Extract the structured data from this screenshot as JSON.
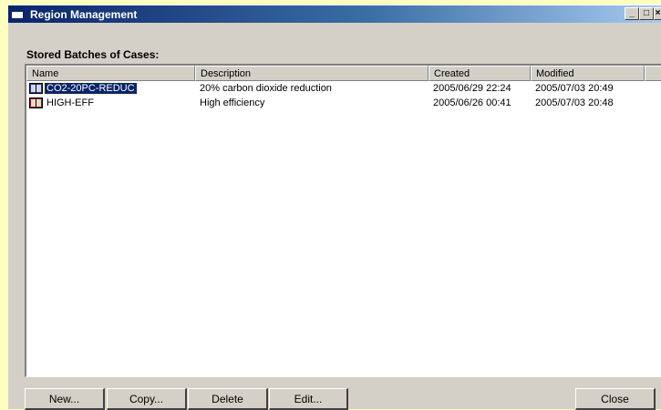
{
  "window": {
    "title": "Region Management",
    "min_glyph": "_",
    "max_glyph": "□",
    "close_glyph": "×"
  },
  "section_label": "Stored Batches of Cases:",
  "list": {
    "columns": [
      "Name",
      "Description",
      "Created",
      "Modified"
    ],
    "rows": [
      {
        "name": "CO2-20PC-REDUC",
        "description": "20% carbon dioxide reduction",
        "created": "2005/06/29 22:24",
        "modified": "2005/07/03 20:49",
        "selected": true
      },
      {
        "name": "HIGH-EFF",
        "description": "High efficiency",
        "created": "2005/06/26 00:41",
        "modified": "2005/07/03 20:48",
        "selected": false
      }
    ]
  },
  "buttons": {
    "new": "New...",
    "copy": "Copy...",
    "delete": "Delete",
    "edit": "Edit...",
    "close": "Close"
  },
  "colors": {
    "selection": "#0a246a",
    "face": "#d4d0c8",
    "titlebar_start": "#0a246a",
    "titlebar_end": "#a6caf0"
  },
  "icons": {
    "row_icon": "book-icon",
    "app_icon": "window-icon"
  }
}
